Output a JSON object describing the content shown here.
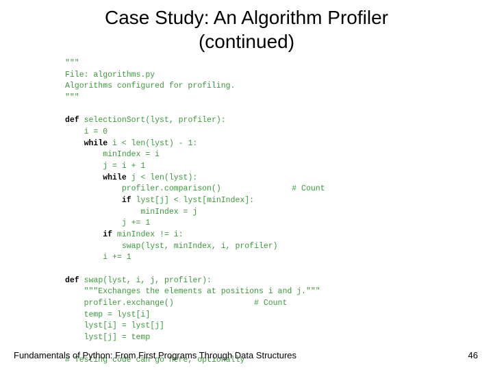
{
  "title_line1": "Case Study: An Algorithm Profiler",
  "title_line2": "(continued)",
  "code": {
    "l01": "\"\"\"",
    "l02": "File: algorithms.py",
    "l03": "Algorithms configured for profiling.",
    "l04": "\"\"\"",
    "l05": "",
    "l06a": "def",
    "l06b": " selectionSort(lyst, profiler):",
    "l07": "    i = 0",
    "l08a": "    ",
    "l08b": "while",
    "l08c": " i < len(lyst) - 1:",
    "l09": "        minIndex = i",
    "l10": "        j = i + 1",
    "l11a": "        ",
    "l11b": "while",
    "l11c": " j < len(lyst):",
    "l12": "            profiler.comparison()               # Count",
    "l13a": "            ",
    "l13b": "if",
    "l13c": " lyst[j] < lyst[minIndex]:",
    "l14": "                minIndex = j",
    "l15": "            j += 1",
    "l16a": "        ",
    "l16b": "if",
    "l16c": " minIndex != i:",
    "l17": "            swap(lyst, minIndex, i, profiler)",
    "l18": "        i += 1",
    "l19": "",
    "l20a": "def",
    "l20b": " swap(lyst, i, j, profiler):",
    "l21": "    \"\"\"Exchanges the elements at positions i and j.\"\"\"",
    "l22": "    profiler.exchange()                 # Count",
    "l23": "    temp = lyst[i]",
    "l24": "    lyst[i] = lyst[j]",
    "l25": "    lyst[j] = temp",
    "l26": "",
    "l27": "# Testing code can go here, optionally"
  },
  "footer": "Fundamentals of Python: From First Programs Through Data Structures",
  "page_number": "46"
}
